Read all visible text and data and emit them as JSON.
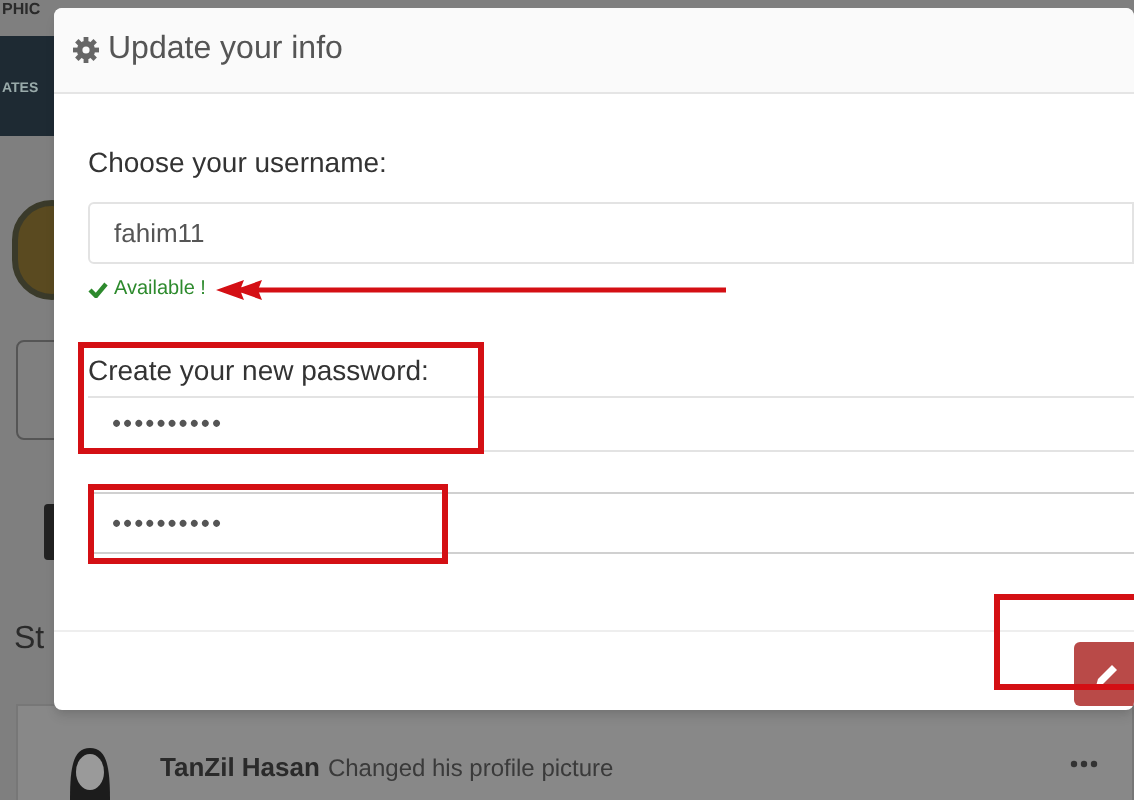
{
  "background": {
    "header": "PHIC",
    "banner": "ATES",
    "section": "St",
    "post": {
      "author": "TanZil Hasan",
      "action": "Changed his profile picture"
    }
  },
  "modal": {
    "title": "Update your info",
    "username": {
      "label": "Choose your username:",
      "value": "fahim11",
      "status": "Available !",
      "available": true
    },
    "password": {
      "label": "Create your new password:",
      "value": "••••••••••"
    },
    "confirm_password": {
      "value": "••••••••••"
    }
  }
}
